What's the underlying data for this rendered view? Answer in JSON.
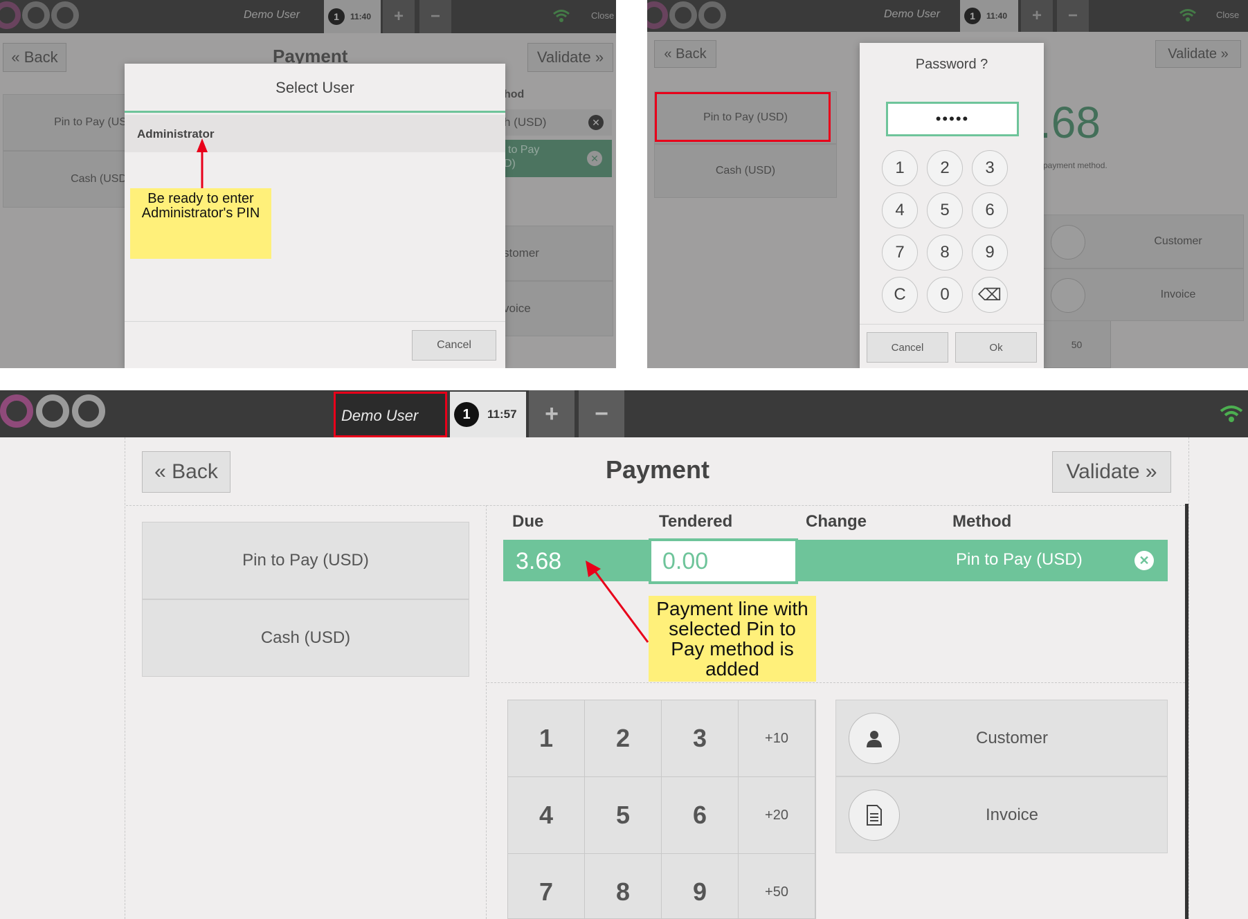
{
  "panel1": {
    "topbar": {
      "user": "Demo User",
      "order_number": "1",
      "time": "11:40",
      "plus": "+",
      "minus": "−",
      "close": "Close"
    },
    "back_label": "« Back",
    "title": "Payment",
    "validate_label": "Validate »",
    "bg_methods": [
      "Pin to Pay (US",
      "Cash (USD"
    ],
    "bg_method_header": "hod",
    "bg_lines": [
      "h (USD)",
      "to Pay",
      "D)"
    ],
    "bg_sections": [
      "stomer",
      "voice"
    ],
    "modal": {
      "title": "Select User",
      "row": "Administrator",
      "cancel": "Cancel"
    },
    "note": "Be ready to enter Administrator's PIN"
  },
  "panel2": {
    "topbar": {
      "user": "Demo User",
      "order_number": "1",
      "time": "11:40",
      "plus": "+",
      "minus": "−",
      "close": "Close"
    },
    "back_label": "« Back",
    "validate_label": "Validate »",
    "methods": [
      "Pin to Pay (USD)",
      "Cash (USD)"
    ],
    "bg_due": ".68",
    "bg_hint": "payment method.",
    "bg_sections": [
      "Customer",
      "Invoice"
    ],
    "bg_fifty": "50",
    "modal": {
      "title": "Password ?",
      "value": "•••••",
      "keys": [
        "1",
        "2",
        "3",
        "4",
        "5",
        "6",
        "7",
        "8",
        "9",
        "C",
        "0",
        "⌫"
      ],
      "cancel": "Cancel",
      "ok": "Ok"
    }
  },
  "panel3": {
    "topbar": {
      "user": "Demo User",
      "order_number": "1",
      "time": "11:57",
      "plus": "+",
      "minus": "−"
    },
    "back_label": "« Back",
    "title": "Payment",
    "validate_label": "Validate »",
    "methods": [
      "Pin to Pay (USD)",
      "Cash (USD)"
    ],
    "columns": [
      "Due",
      "Tendered",
      "Change",
      "Method"
    ],
    "line": {
      "due": "3.68",
      "tendered": "0.00",
      "method": "Pin to Pay (USD)"
    },
    "numpad": [
      "1",
      "2",
      "3",
      "+10",
      "4",
      "5",
      "6",
      "+20",
      "7",
      "8",
      "9",
      "+50"
    ],
    "sections": [
      "Customer",
      "Invoice"
    ],
    "note": "Payment line with selected Pin to Pay method is added"
  },
  "colors": {
    "accent": "#6ec49a",
    "topbar": "#3a3a3a",
    "highlight": "#e8001a",
    "note": "#fff07a"
  }
}
